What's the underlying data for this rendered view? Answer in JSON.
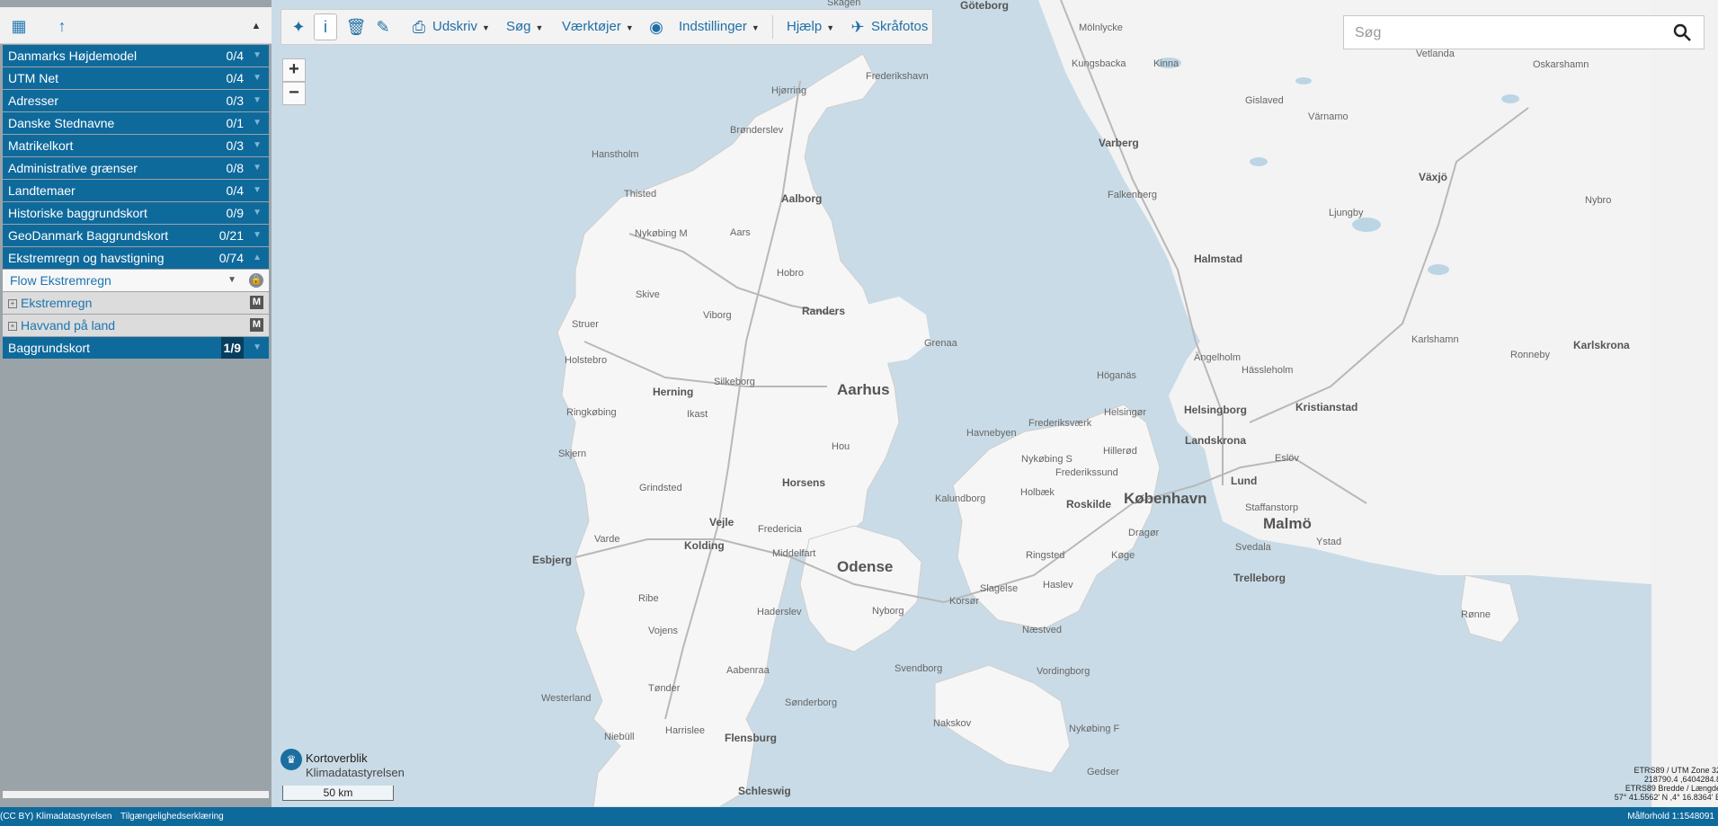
{
  "sidebar": {
    "layers": [
      {
        "name": "Danmarks Højdemodel",
        "count": "0/4"
      },
      {
        "name": "UTM Net",
        "count": "0/4"
      },
      {
        "name": "Adresser",
        "count": "0/3"
      },
      {
        "name": "Danske Stednavne",
        "count": "0/1"
      },
      {
        "name": "Matrikelkort",
        "count": "0/3"
      },
      {
        "name": "Administrative grænser",
        "count": "0/8"
      },
      {
        "name": "Landtemaer",
        "count": "0/4"
      },
      {
        "name": "Historiske baggrundskort",
        "count": "0/9"
      },
      {
        "name": "GeoDanmark Baggrundskort",
        "count": "0/21"
      },
      {
        "name": "Ekstremregn og havstigning",
        "count": "0/74"
      }
    ],
    "selected_sublayer": "Flow Ekstremregn",
    "items": [
      {
        "name": "Ekstremregn",
        "badge": "M"
      },
      {
        "name": "Havvand på land",
        "badge": "M"
      }
    ],
    "baggrund": {
      "name": "Baggrundskort",
      "count": "1/9"
    }
  },
  "toolbar": {
    "print": "Udskriv",
    "search": "Søg",
    "tools": "Værktøjer",
    "settings": "Indstillinger",
    "help": "Hjælp",
    "oblique": "Skråfotos"
  },
  "search": {
    "placeholder": "Søg"
  },
  "logo": {
    "line1": "Kortoverblik",
    "line2": "Klimadatastyrelsen"
  },
  "scale": "50 km",
  "coords": {
    "line1": "ETRS89 / UTM Zone 32",
    "line2": "218790.4 ,6404284.8",
    "line3": "ETRS89 Bredde / Længde",
    "line4": "57° 41.5562' N ,4° 16.8364' E"
  },
  "status": {
    "license": "(CC BY) Klimadatastyrelsen",
    "accessibility": "Tilgængelighedserklæring",
    "scale": "Målforhold 1:1548091"
  },
  "map": {
    "cities": [
      {
        "name": "Göteborg",
        "kind": "big"
      },
      {
        "name": "Mölnlycke",
        "kind": "s"
      },
      {
        "name": "Kungsbacka",
        "kind": "s"
      },
      {
        "name": "Kinna",
        "kind": "s"
      },
      {
        "name": "Vetlanda",
        "kind": "s"
      },
      {
        "name": "Oskarshamn",
        "kind": "s"
      },
      {
        "name": "Gislaved",
        "kind": "s"
      },
      {
        "name": "Värnamo",
        "kind": "s"
      },
      {
        "name": "Varberg",
        "kind": "big"
      },
      {
        "name": "Falkenberg",
        "kind": "s"
      },
      {
        "name": "Växjö",
        "kind": "big"
      },
      {
        "name": "Ljungby",
        "kind": "s"
      },
      {
        "name": "Nybro",
        "kind": "s"
      },
      {
        "name": "Halmstad",
        "kind": "big"
      },
      {
        "name": "Karlshamn",
        "kind": "s"
      },
      {
        "name": "Ronneby",
        "kind": "s"
      },
      {
        "name": "Karlskrona",
        "kind": "big"
      },
      {
        "name": "Ängelholm",
        "kind": "s"
      },
      {
        "name": "Hässleholm",
        "kind": "s"
      },
      {
        "name": "Höganäs",
        "kind": "s"
      },
      {
        "name": "Helsingør",
        "kind": "s"
      },
      {
        "name": "Helsingborg",
        "kind": "big"
      },
      {
        "name": "Kristianstad",
        "kind": "big"
      },
      {
        "name": "Landskrona",
        "kind": "big"
      },
      {
        "name": "Eslöv",
        "kind": "s"
      },
      {
        "name": "Lund",
        "kind": "big"
      },
      {
        "name": "Staffanstorp",
        "kind": "s"
      },
      {
        "name": "Malmö",
        "kind": "cap"
      },
      {
        "name": "Ystad",
        "kind": "s"
      },
      {
        "name": "Svedala",
        "kind": "s"
      },
      {
        "name": "Trelleborg",
        "kind": "big"
      },
      {
        "name": "Rønne",
        "kind": "s"
      },
      {
        "name": "Frederikshavn",
        "kind": "s"
      },
      {
        "name": "Hjørring",
        "kind": "s"
      },
      {
        "name": "Brønderslev",
        "kind": "s"
      },
      {
        "name": "Hanstholm",
        "kind": "s"
      },
      {
        "name": "Thisted",
        "kind": "s"
      },
      {
        "name": "Aalborg",
        "kind": "big"
      },
      {
        "name": "Nykøbing M",
        "kind": "s"
      },
      {
        "name": "Aars",
        "kind": "s"
      },
      {
        "name": "Hobro",
        "kind": "s"
      },
      {
        "name": "Skive",
        "kind": "s"
      },
      {
        "name": "Viborg",
        "kind": "s"
      },
      {
        "name": "Randers",
        "kind": "big"
      },
      {
        "name": "Struer",
        "kind": "s"
      },
      {
        "name": "Holstebro",
        "kind": "s"
      },
      {
        "name": "Grenaa",
        "kind": "s"
      },
      {
        "name": "Herning",
        "kind": "big"
      },
      {
        "name": "Silkeborg",
        "kind": "s"
      },
      {
        "name": "Aarhus",
        "kind": "cap"
      },
      {
        "name": "Ringkøbing",
        "kind": "s"
      },
      {
        "name": "Ikast",
        "kind": "s"
      },
      {
        "name": "Skjern",
        "kind": "s"
      },
      {
        "name": "Grindsted",
        "kind": "s"
      },
      {
        "name": "Horsens",
        "kind": "big"
      },
      {
        "name": "Hou",
        "kind": "s"
      },
      {
        "name": "Havnebyen",
        "kind": "s"
      },
      {
        "name": "Frederiksværk",
        "kind": "s"
      },
      {
        "name": "Hillerød",
        "kind": "s"
      },
      {
        "name": "Nykøbing S",
        "kind": "s"
      },
      {
        "name": "Frederikssund",
        "kind": "s"
      },
      {
        "name": "Holbæk",
        "kind": "s"
      },
      {
        "name": "Roskilde",
        "kind": "big"
      },
      {
        "name": "København",
        "kind": "cap"
      },
      {
        "name": "Kalundborg",
        "kind": "s"
      },
      {
        "name": "Dragør",
        "kind": "s"
      },
      {
        "name": "Vejle",
        "kind": "big"
      },
      {
        "name": "Fredericia",
        "kind": "s"
      },
      {
        "name": "Varde",
        "kind": "s"
      },
      {
        "name": "Kolding",
        "kind": "big"
      },
      {
        "name": "Middelfart",
        "kind": "s"
      },
      {
        "name": "Odense",
        "kind": "cap"
      },
      {
        "name": "Esbjerg",
        "kind": "big"
      },
      {
        "name": "Ringsted",
        "kind": "s"
      },
      {
        "name": "Køge",
        "kind": "s"
      },
      {
        "name": "Slagelse",
        "kind": "s"
      },
      {
        "name": "Haslev",
        "kind": "s"
      },
      {
        "name": "Korsør",
        "kind": "s"
      },
      {
        "name": "Nyborg",
        "kind": "s"
      },
      {
        "name": "Ribe",
        "kind": "s"
      },
      {
        "name": "Haderslev",
        "kind": "s"
      },
      {
        "name": "Vojens",
        "kind": "s"
      },
      {
        "name": "Næstved",
        "kind": "s"
      },
      {
        "name": "Svendborg",
        "kind": "s"
      },
      {
        "name": "Vordingborg",
        "kind": "s"
      },
      {
        "name": "Aabenraa",
        "kind": "s"
      },
      {
        "name": "Tønder",
        "kind": "s"
      },
      {
        "name": "Sønderborg",
        "kind": "s"
      },
      {
        "name": "Westerland",
        "kind": "s"
      },
      {
        "name": "Nakskov",
        "kind": "s"
      },
      {
        "name": "Nykøbing F",
        "kind": "s"
      },
      {
        "name": "Niebüll",
        "kind": "s"
      },
      {
        "name": "Harrislee",
        "kind": "s"
      },
      {
        "name": "Flensburg",
        "kind": "big"
      },
      {
        "name": "Gedser",
        "kind": "s"
      },
      {
        "name": "Schleswig",
        "kind": "big"
      },
      {
        "name": "Skagen",
        "kind": "s"
      }
    ]
  }
}
